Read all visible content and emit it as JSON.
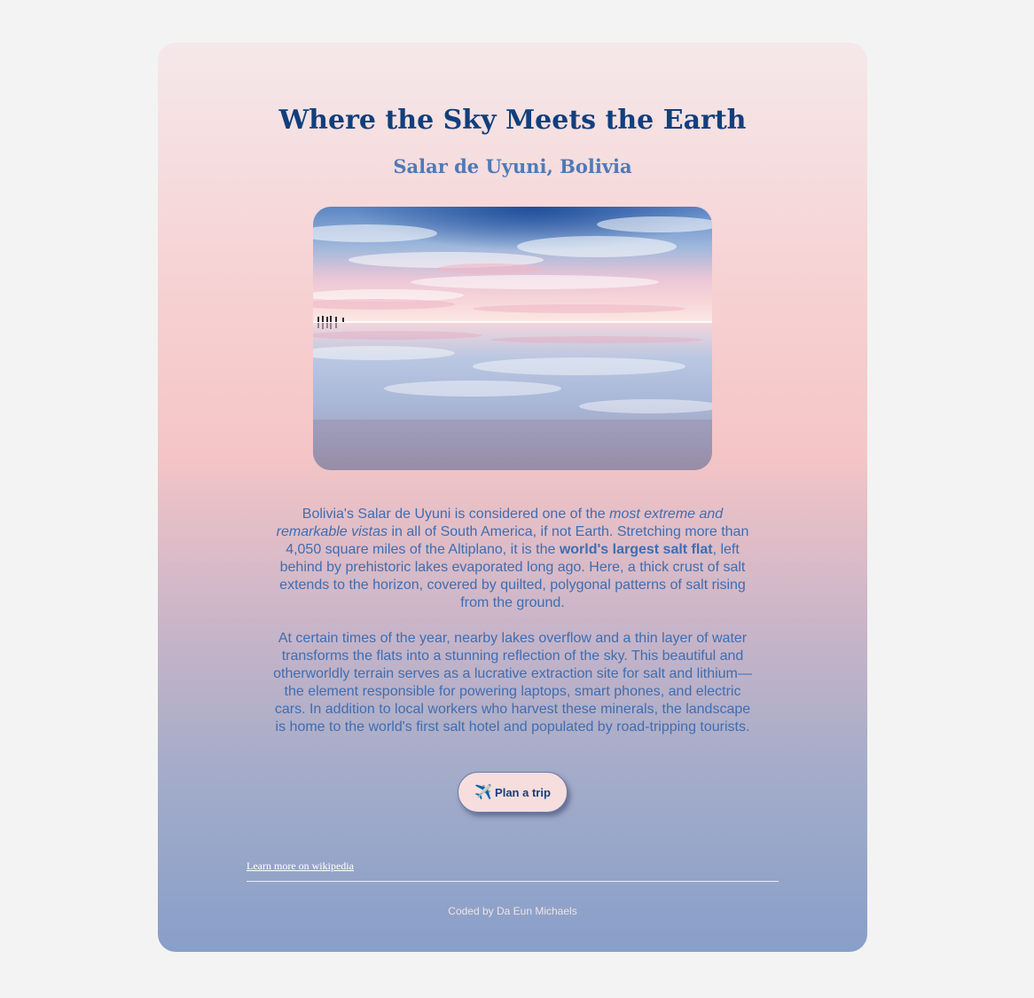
{
  "header": {
    "title": "Where the Sky Meets the Earth",
    "subtitle": "Salar de Uyuni, Bolivia"
  },
  "content": {
    "p1": {
      "t1": "Bolivia's Salar de Uyuni is considered one of the ",
      "em": "most extreme and remarkable vistas",
      "t2": " in all of South America, if not Earth. Stretching more than 4,050 square miles of the Altiplano, it is the ",
      "strong": "world's largest salt flat",
      "t3": ", left behind by prehistoric lakes evaporated long ago. Here, a thick crust of salt extends to the horizon, covered by quilted, polygonal patterns of salt rising from the ground."
    },
    "p2": "At certain times of the year, nearby lakes overflow and a thin layer of water transforms the flats into a stunning reflection of the sky. This beautiful and otherworldly terrain serves as a lucrative extraction site for salt and lithium—the element responsible for powering laptops, smart phones, and electric cars. In addition to local workers who harvest these minerals, the landscape is home to the world's first salt hotel and populated by road-tripping tourists."
  },
  "cta": {
    "icon": "✈️",
    "label": "Plan a trip"
  },
  "footer": {
    "link": "Learn more on wikipedia",
    "credit": "Coded by Da Eun Michaels"
  },
  "colors": {
    "title": "#123f7c",
    "subtitle": "#4f7ab6",
    "body_text": "#3f6db1",
    "button_bg": "#f6dede",
    "page_bg": "#f3f3f3"
  }
}
